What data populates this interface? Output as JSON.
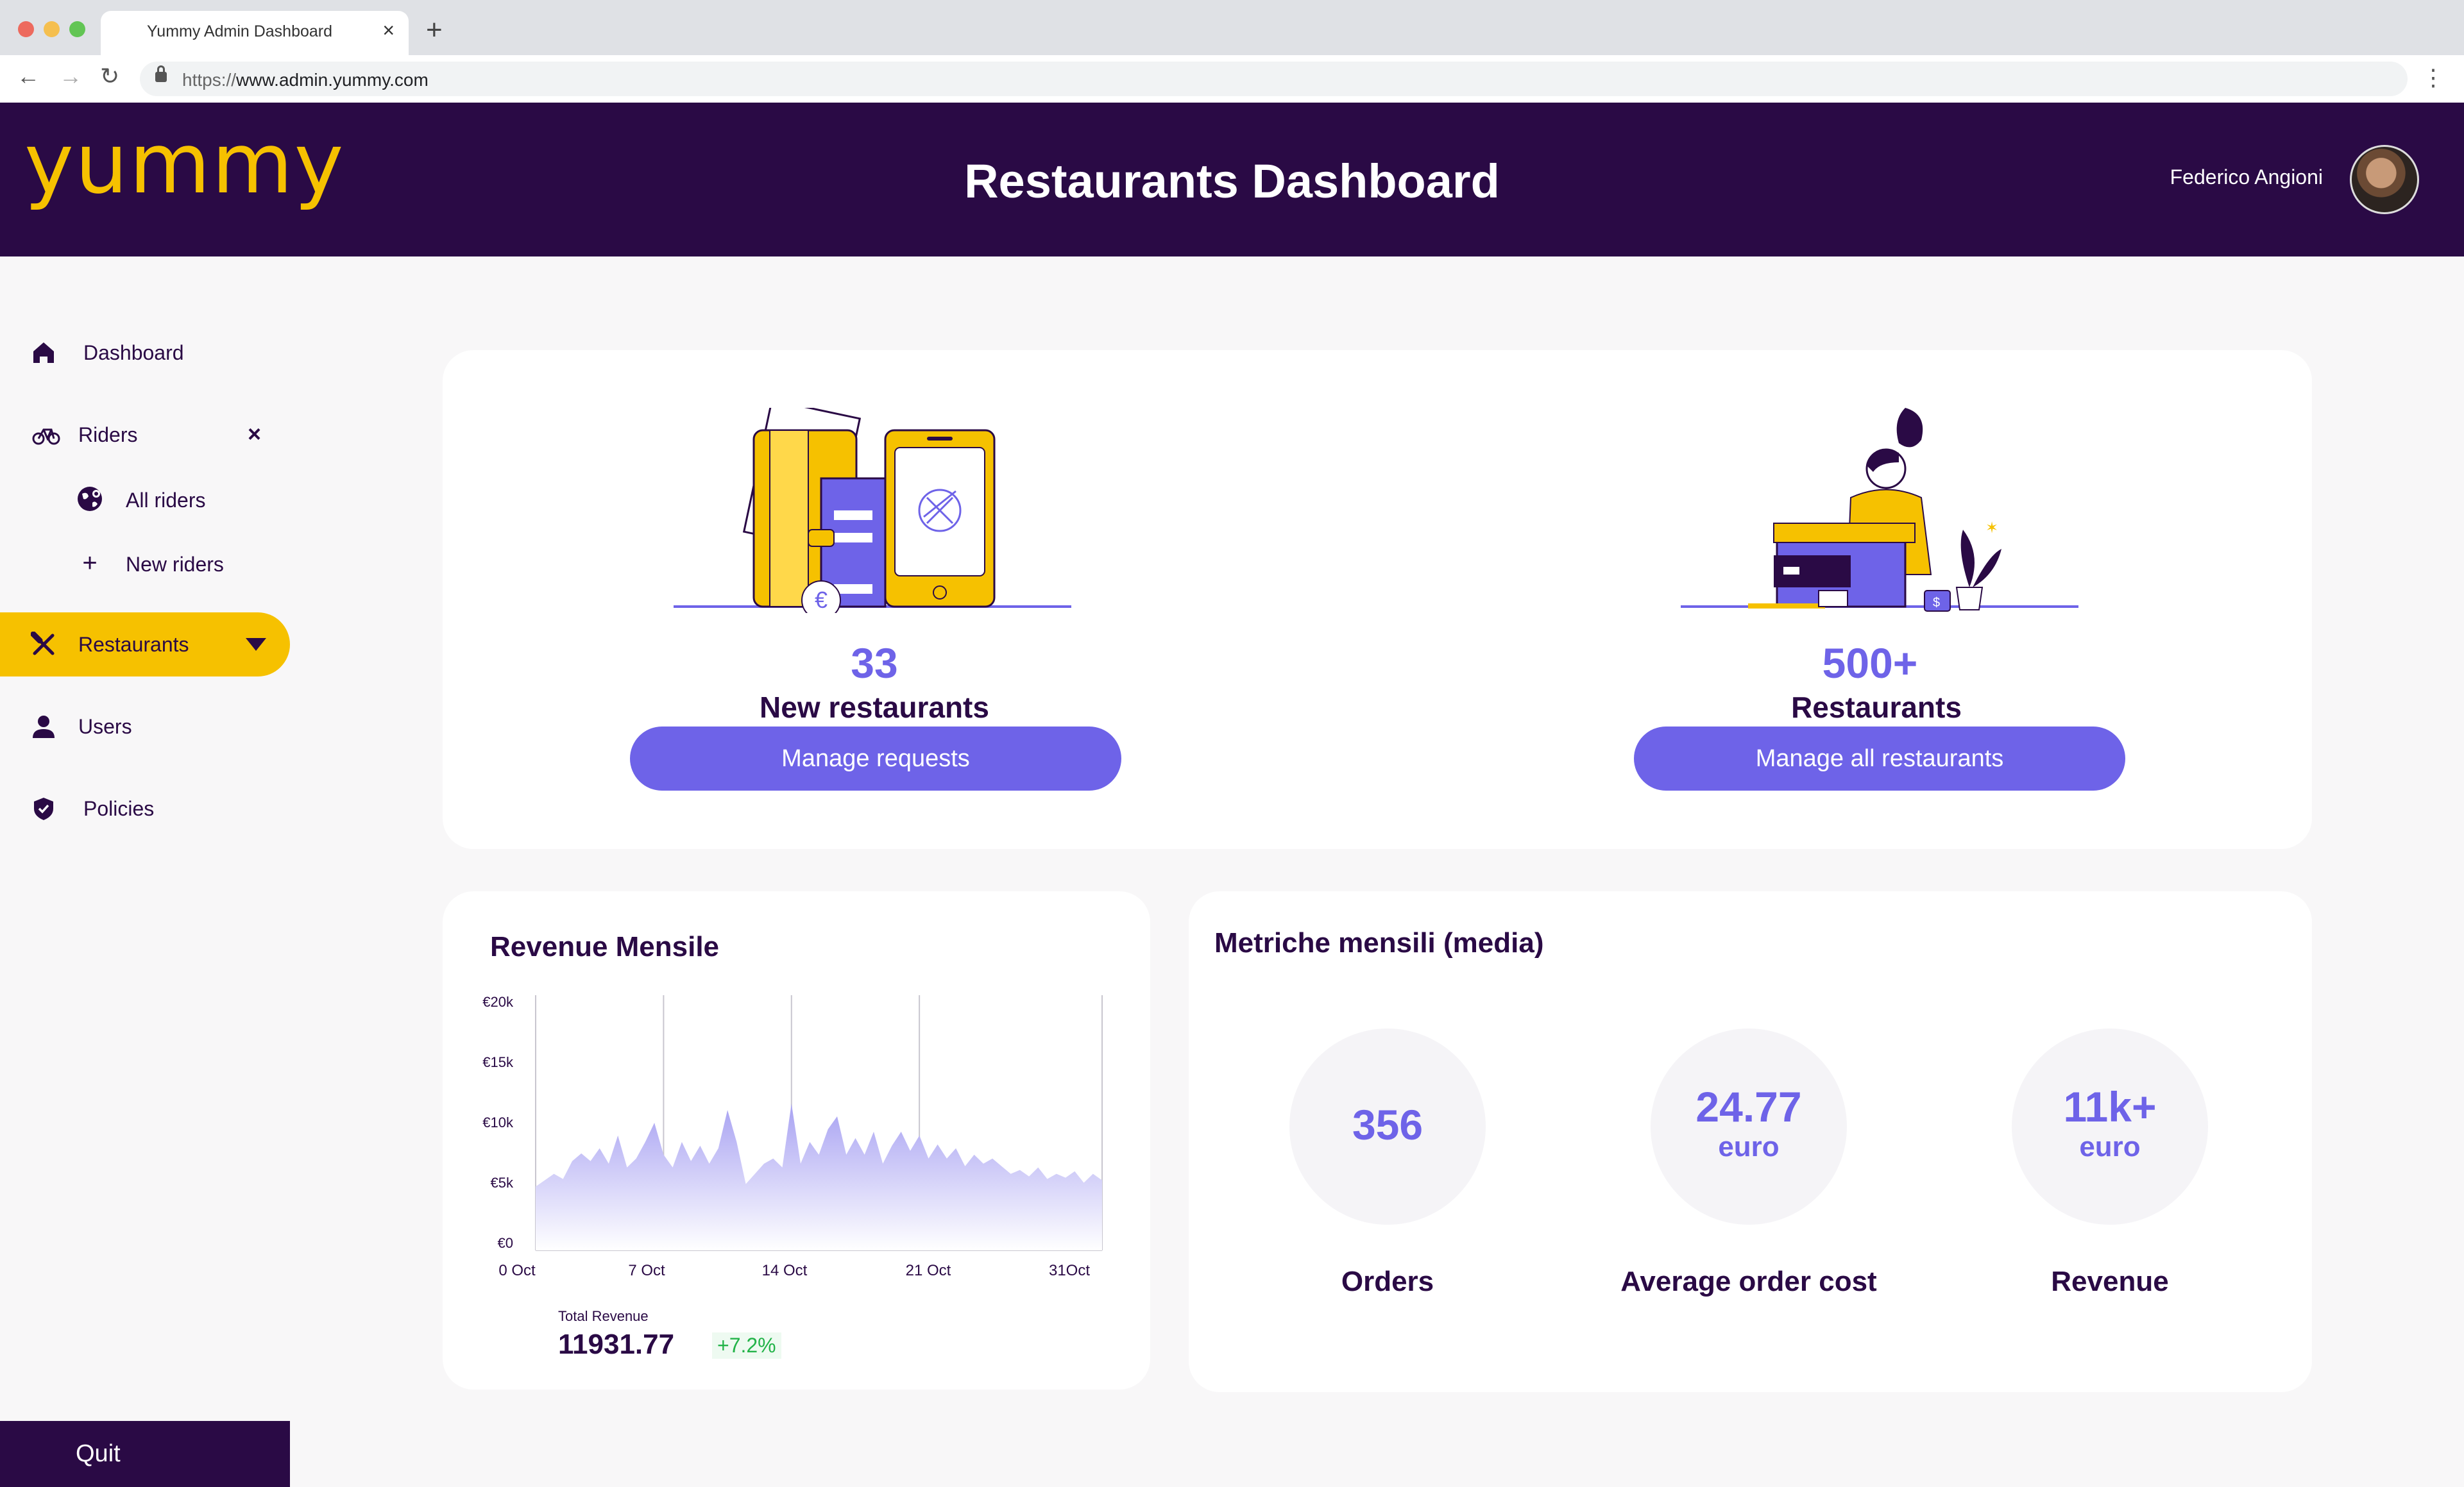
{
  "browser": {
    "tab_title": "Yummy Admin Dashboard",
    "url_scheme": "https://",
    "url_host": "www.admin.yummy.com"
  },
  "header": {
    "logo_text": "yummy",
    "title": "Restaurants Dashboard",
    "user_name": "Federico Angioni"
  },
  "sidebar": {
    "items": [
      {
        "label": "Dashboard",
        "icon": "home-icon"
      },
      {
        "label": "Riders",
        "icon": "bicycle-icon"
      },
      {
        "label": "All riders",
        "icon": "globe-pin-icon"
      },
      {
        "label": "New riders",
        "icon": "plus-icon"
      },
      {
        "label": "Restaurants",
        "icon": "utensils-icon"
      },
      {
        "label": "Users",
        "icon": "user-icon"
      },
      {
        "label": "Policies",
        "icon": "shield-icon"
      }
    ],
    "quit_label": "Quit"
  },
  "overview": {
    "new_restaurants_count": "33",
    "new_restaurants_label": "New restaurants",
    "manage_requests_label": "Manage requests",
    "restaurants_count": "500+",
    "restaurants_label": "Restaurants",
    "manage_all_label": "Manage all restaurants"
  },
  "revenue": {
    "title": "Revenue Mensile",
    "total_label": "Total Revenue",
    "total_value": "11931.77",
    "delta": "+7.2%"
  },
  "chart_data": {
    "type": "area",
    "title": "Revenue Mensile",
    "x_ticks": [
      "0 Oct",
      "7 Oct",
      "14 Oct",
      "21 Oct",
      "31Oct"
    ],
    "y_ticks": [
      "€20k",
      "€15k",
      "€10k",
      "€5k",
      "€0"
    ],
    "ylim": [
      0,
      20000
    ],
    "xlim": [
      0,
      31
    ],
    "x": [
      0,
      0.5,
      1,
      1.5,
      2,
      2.5,
      3,
      3.5,
      4,
      4.5,
      5,
      5.5,
      6,
      6.5,
      7,
      7.5,
      8,
      8.5,
      9,
      9.5,
      10,
      10.5,
      11,
      11.5,
      12,
      12.5,
      13,
      13.5,
      14,
      14.5,
      15,
      15.5,
      16,
      16.5,
      17,
      17.5,
      18,
      18.5,
      19,
      19.5,
      20,
      20.5,
      21,
      21.5,
      22,
      22.5,
      23,
      23.5,
      24,
      24.5,
      25,
      25.5,
      26,
      26.5,
      27,
      27.5,
      28,
      28.5,
      29,
      29.5,
      30,
      30.5,
      31
    ],
    "values": [
      5000,
      5500,
      6000,
      5600,
      7000,
      7600,
      7000,
      8000,
      6800,
      9000,
      6500,
      7200,
      8500,
      10000,
      7500,
      6500,
      8500,
      7000,
      8200,
      6800,
      8000,
      11000,
      8500,
      5200,
      6000,
      6800,
      7200,
      6500,
      11500,
      6800,
      8500,
      7500,
      9500,
      10500,
      7500,
      8800,
      7500,
      9300,
      6800,
      8200,
      9300,
      7800,
      9000,
      7200,
      8300,
      7200,
      8000,
      6600,
      7500,
      6800,
      7200,
      6600,
      6000,
      6300,
      5800,
      6500,
      5600,
      6000,
      5700,
      6200,
      5300,
      6000,
      5500
    ],
    "grid": "vertical",
    "colors": {
      "fill_top": "#a8a2f2",
      "fill_bottom": "#ffffff"
    }
  },
  "metrics": {
    "title": "Metriche mensili (media)",
    "items": [
      {
        "value": "356",
        "unit": "",
        "label": "Orders"
      },
      {
        "value": "24.77",
        "unit": "euro",
        "label": "Average order cost"
      },
      {
        "value": "11k+",
        "unit": "euro",
        "label": "Revenue"
      }
    ]
  },
  "colors": {
    "brand_dark": "#2a0a45",
    "brand_yellow": "#f6c100",
    "accent_purple": "#6e63e8",
    "positive_green": "#22b348"
  }
}
